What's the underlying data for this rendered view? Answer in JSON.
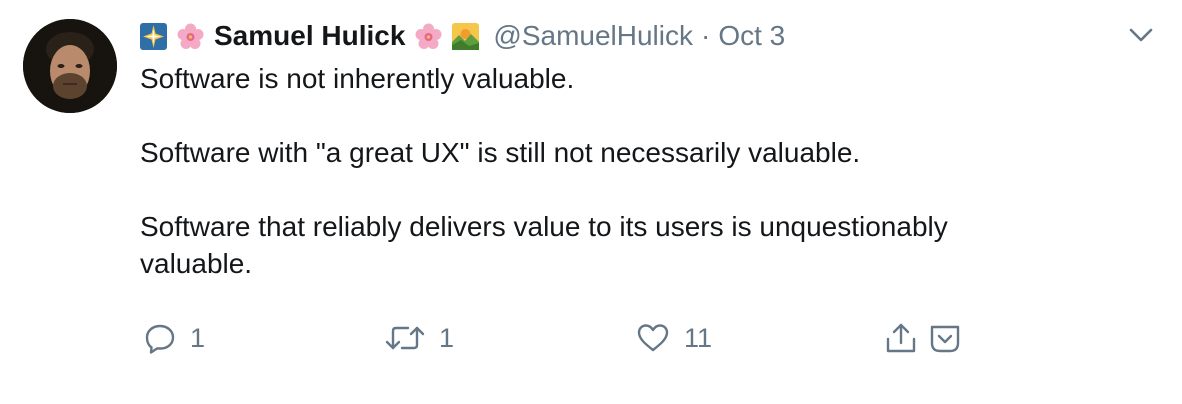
{
  "tweet": {
    "display_name": "Samuel Hulick",
    "handle": "@SamuelHulick",
    "separator": "·",
    "date": "Oct 3",
    "name_emojis_before": [
      "sparkle-tile-emoji",
      "cherry-blossom-emoji"
    ],
    "name_emojis_after": [
      "cherry-blossom-emoji",
      "sunrise-over-mountains-emoji"
    ],
    "paragraphs": [
      "Software is not inherently valuable.",
      "Software with \"a great UX\" is still not necessarily valuable.",
      "Software that reliably delivers value to its users is unquestionably valuable."
    ],
    "actions": {
      "reply_count": "1",
      "retweet_count": "1",
      "like_count": "11"
    }
  },
  "colors": {
    "text": "#14171a",
    "secondary": "#657786",
    "background": "#ffffff"
  }
}
